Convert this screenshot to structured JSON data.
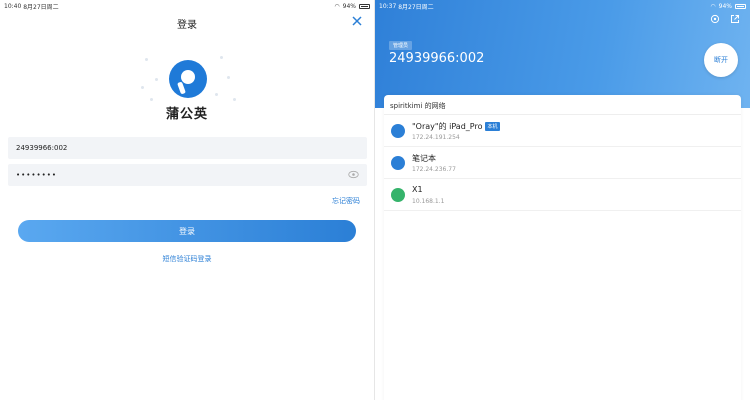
{
  "login": {
    "status": {
      "time": "10:40",
      "date": "8月27日周二",
      "battery": "94%"
    },
    "title": "登录",
    "brand": "蒲公英",
    "username": "24939966:002",
    "password_mask": "••••••••",
    "forgot_label": "忘记密码",
    "login_label": "登录",
    "sms_login_label": "短信验证码登录"
  },
  "network": {
    "status": {
      "time": "10:37",
      "date": "8月27日周二",
      "battery": "94%"
    },
    "role_badge": "管理员",
    "sn": "24939966:002",
    "disconnect_label": "断开",
    "network_title": "spiritkimi 的网络",
    "devices": [
      {
        "name": "\"Oray\"的 iPad_Pro",
        "badge": "本机",
        "ip": "172.24.191.254",
        "icon": "person-icon"
      },
      {
        "name": "笔记本",
        "badge": "",
        "ip": "172.24.236.77",
        "icon": "person-icon"
      },
      {
        "name": "X1",
        "badge": "",
        "ip": "10.168.1.1",
        "icon": "router-icon"
      }
    ]
  },
  "colors": {
    "accent": "#2b7fd6",
    "router": "#35b36b"
  }
}
